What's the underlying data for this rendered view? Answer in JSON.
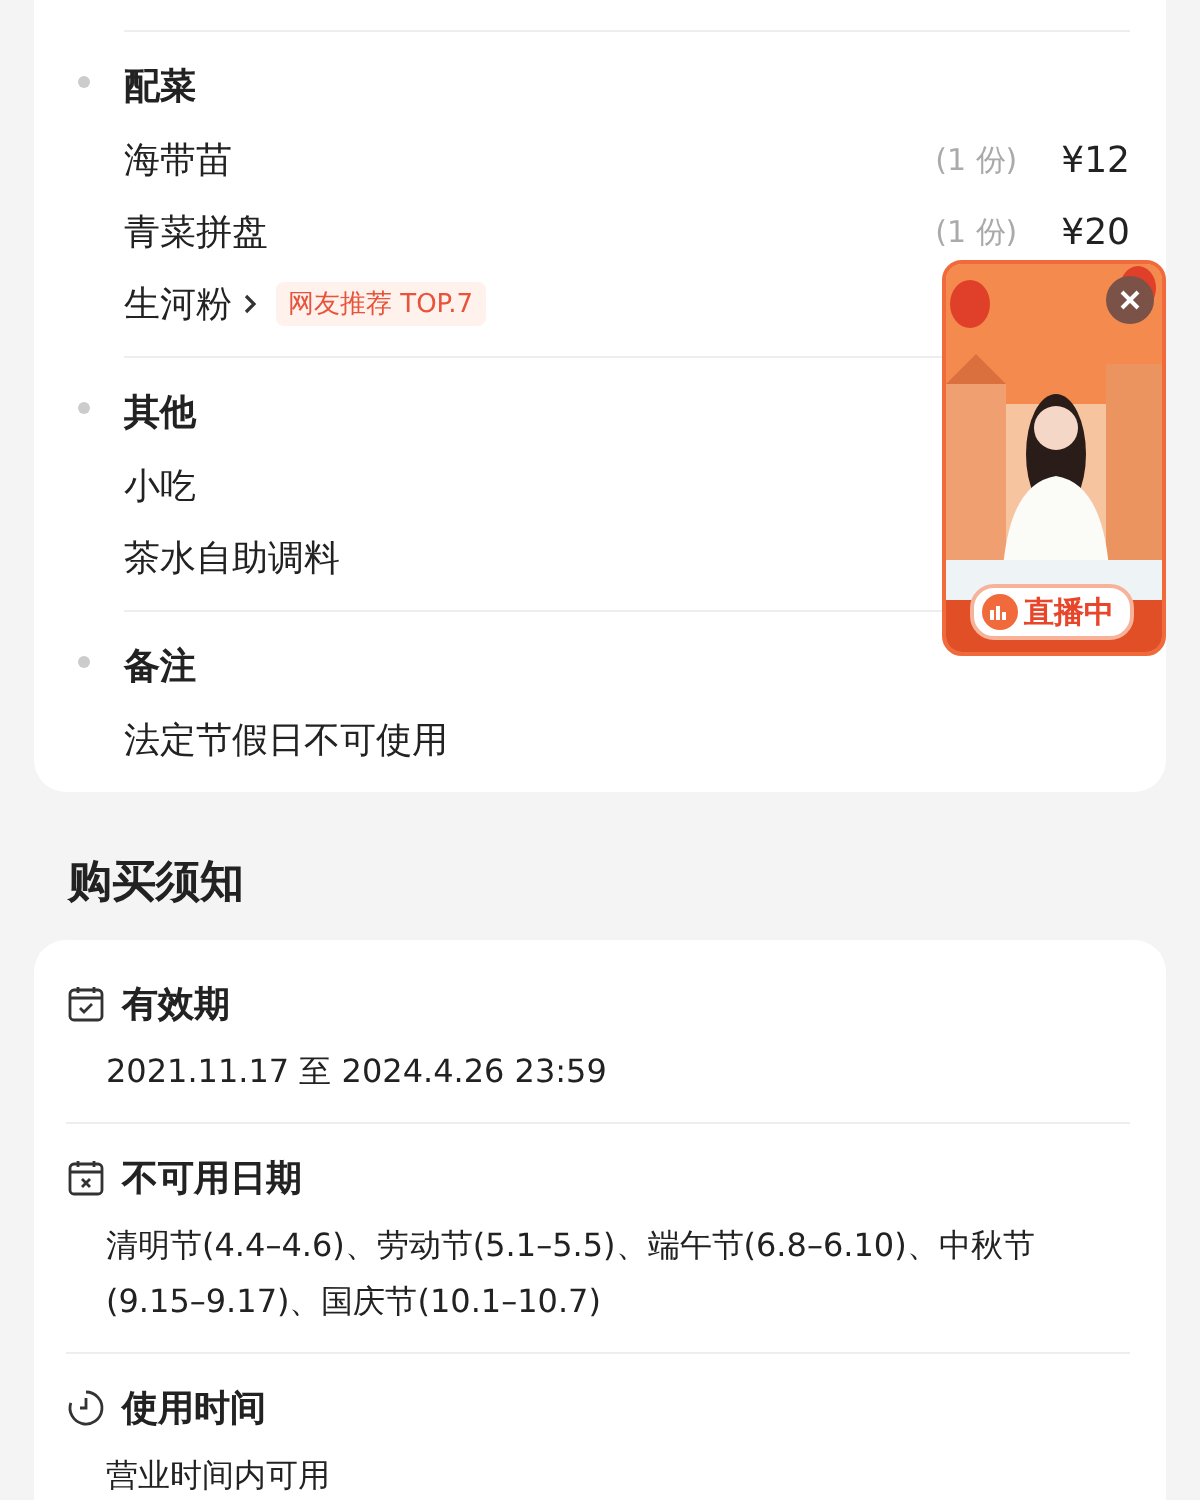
{
  "menu_card": {
    "groups": [
      {
        "title": "配菜",
        "items": [
          {
            "name": "海带苗",
            "expandable": false,
            "quantity": "(1 份)",
            "price": "¥12"
          },
          {
            "name": "青菜拼盘",
            "expandable": false,
            "quantity": "(1 份)",
            "price": "¥20"
          },
          {
            "name": "生河粉",
            "expandable": true,
            "tag": "网友推荐 TOP.7"
          }
        ]
      },
      {
        "title": "其他",
        "items": [
          {
            "name": "小吃",
            "expandable": false
          },
          {
            "name": "茶水自助调料",
            "expandable": false
          }
        ]
      },
      {
        "title": "备注",
        "items": [
          {
            "name": "法定节假日不可使用",
            "expandable": false
          }
        ]
      }
    ]
  },
  "live_widget": {
    "badge": "直播中"
  },
  "notice": {
    "title": "购买须知",
    "sections": [
      {
        "kind": "calendar-check",
        "title": "有效期",
        "text": "2021.11.17 至 2024.4.26 23:59"
      },
      {
        "kind": "calendar-x",
        "title": "不可用日期",
        "text": "清明节(4.4–4.6)、劳动节(5.1–5.5)、端午节(6.8–6.10)、中秋节(9.15–9.17)、国庆节(10.1–10.7)"
      },
      {
        "kind": "clock",
        "title": "使用时间",
        "text": "营业时间内可用"
      }
    ]
  }
}
